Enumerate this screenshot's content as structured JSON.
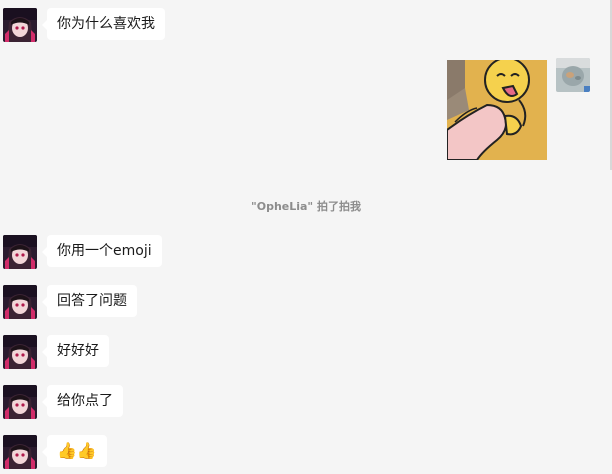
{
  "conversation": {
    "messages": [
      {
        "text": "你为什么喜欢我"
      },
      {
        "text": "你用一个emoji"
      },
      {
        "text": "回答了问题"
      },
      {
        "text": "好好好"
      },
      {
        "text": "给你点了"
      },
      {
        "text": "👍👍"
      }
    ],
    "system_notice": "\"OpheLia\" 拍了拍我"
  },
  "icons": {
    "left_avatar": "anime-girl-avatar-icon",
    "right_avatar": "cat-photo-avatar-icon",
    "sticker": "yellow-character-licking-foot-sticker",
    "thumbs": "thumbs-up-icon"
  },
  "colors": {
    "background": "#f5f5f5",
    "bubble": "#ffffff",
    "system_text": "#8c8c8c",
    "sticker_bg": "#e2b24e"
  }
}
